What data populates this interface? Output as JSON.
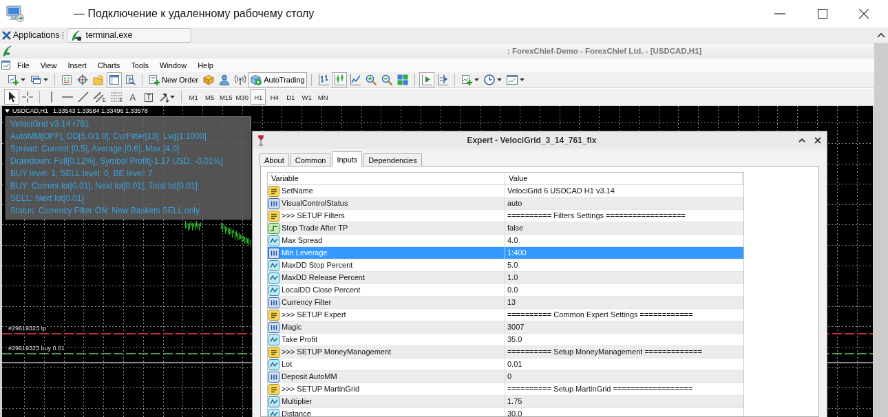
{
  "remote_window": {
    "title": "— Подключение к удаленному рабочему столу"
  },
  "taskbar": {
    "menu_label": "Applications",
    "tasks": [
      {
        "label": "terminal.exe"
      }
    ]
  },
  "terminal": {
    "title": ": ForexChief-Demo - ForexChief Ltd. - [USDCAD,H1]",
    "menu": [
      "File",
      "View",
      "Insert",
      "Charts",
      "Tools",
      "Window",
      "Help"
    ],
    "toolbar": [
      {
        "items": [
          {
            "kind": "new-chart",
            "dropdown": true,
            "on": false
          },
          {
            "kind": "profiles",
            "dropdown": true,
            "on": false
          }
        ]
      },
      {
        "items": [
          {
            "kind": "market-watch",
            "on": false
          },
          {
            "kind": "data-window",
            "on": false
          },
          {
            "kind": "navigator",
            "on": false
          },
          {
            "kind": "terminal",
            "on": true
          },
          {
            "kind": "tester",
            "on": false
          }
        ]
      },
      {
        "items": [
          {
            "kind": "new-order",
            "label": "New Order",
            "on": false
          },
          {
            "kind": "editor",
            "on": false
          },
          {
            "kind": "community",
            "on": false
          },
          {
            "kind": "signals",
            "on": false
          },
          {
            "kind": "autotrading",
            "label": "AutoTrading",
            "on": true
          }
        ]
      },
      {
        "items": [
          {
            "kind": "bar-chart",
            "on": false
          },
          {
            "kind": "candles",
            "on": true
          },
          {
            "kind": "line-chart",
            "on": false
          },
          {
            "kind": "zoom-in",
            "on": false
          },
          {
            "kind": "zoom-out",
            "on": false
          },
          {
            "kind": "tile",
            "on": false
          }
        ]
      },
      {
        "items": [
          {
            "kind": "autoscroll",
            "on": true
          },
          {
            "kind": "chart-shift",
            "on": false
          }
        ]
      },
      {
        "items": [
          {
            "kind": "indicators",
            "dropdown": true,
            "on": false
          },
          {
            "kind": "periods",
            "dropdown": true,
            "on": false
          },
          {
            "kind": "templates",
            "dropdown": true,
            "on": false
          }
        ]
      }
    ],
    "drawing_tools": [
      {
        "items": [
          {
            "kind": "cursor",
            "selected": true
          },
          {
            "kind": "crosshair",
            "selected": false
          }
        ]
      },
      {
        "items": [
          {
            "kind": "vline",
            "selected": false
          },
          {
            "kind": "hline",
            "selected": false
          },
          {
            "kind": "trendline",
            "selected": false
          },
          {
            "kind": "channel",
            "glyph": "E",
            "selected": false
          },
          {
            "kind": "fibo",
            "glyph": "F",
            "selected": false
          },
          {
            "kind": "text",
            "glyph": "A",
            "selected": false
          },
          {
            "kind": "label",
            "glyph": "T",
            "selected": false
          },
          {
            "kind": "arrows",
            "selected": false
          }
        ]
      }
    ],
    "timeframes": [
      {
        "label": "M1",
        "selected": false
      },
      {
        "label": "M5",
        "selected": false
      },
      {
        "label": "M15",
        "selected": false
      },
      {
        "label": "M30",
        "selected": false
      },
      {
        "label": "H1",
        "selected": true
      },
      {
        "label": "H4",
        "selected": false
      },
      {
        "label": "D1",
        "selected": false
      },
      {
        "label": "W1",
        "selected": false
      },
      {
        "label": "MN",
        "selected": false
      }
    ]
  },
  "chart": {
    "symbol": "USDCAD,H1",
    "quotes": "1.33543 1.33584 1.33496 1.33578",
    "info_lines": [
      "VelociGrid v3.14 r761",
      "AutoMM[OFF], DD[5.0/1.0], CurFilter[13], Lvg[1:1000]",
      "Spread: Current [0.5], Average [0.6], Max [4.0]",
      "Drawdown: Full[0.12%], Symbol Profit[-1.17 USD, -0.01%]",
      "BUY level: 1, SELL level: 0, BE level: 7",
      "BUY: Current lot[0.01], Next lot[0.01], Total lot[0.01]",
      "SELL: Next lot[0.01]",
      "Status: Currency Filter ON: New Baskets SELL only."
    ],
    "order_lines": [
      {
        "label": "#29619323 tp",
        "color": "#c03030"
      },
      {
        "label": "#29619323 buy 0.01",
        "color": "#4c9a4c"
      }
    ]
  },
  "expert_dialog": {
    "title": "Expert - VelociGrid_3_14_761_fix",
    "tabs": [
      {
        "label": "About",
        "selected": false
      },
      {
        "label": "Common",
        "selected": false
      },
      {
        "label": "Inputs",
        "selected": true
      },
      {
        "label": "Dependencies",
        "selected": false
      }
    ],
    "columns": [
      "Variable",
      "Value"
    ],
    "rows": [
      {
        "kind": "string",
        "name": "SetName",
        "value": "VelociGrid 6 USDCAD H1 v3.14",
        "selected": false
      },
      {
        "kind": "int",
        "name": "VisualControlStatus",
        "value": "auto",
        "selected": false
      },
      {
        "kind": "string",
        "name": ">>> SETUP Filters",
        "value": "========== Filters Settings ==================",
        "selected": false
      },
      {
        "kind": "bool",
        "name": "Stop Trade After TP",
        "value": "false",
        "selected": false
      },
      {
        "kind": "double",
        "name": "Max Spread",
        "value": "4.0",
        "selected": false
      },
      {
        "kind": "int",
        "name": "Min Leverage",
        "value": "1:400",
        "selected": true
      },
      {
        "kind": "double",
        "name": "MaxDD Stop Percent",
        "value": "5.0",
        "selected": false
      },
      {
        "kind": "double",
        "name": "MaxDD Release Percent",
        "value": "1.0",
        "selected": false
      },
      {
        "kind": "double",
        "name": "LocalDD Close Percent",
        "value": "0.0",
        "selected": false
      },
      {
        "kind": "int",
        "name": "Currency Filter",
        "value": "13",
        "selected": false
      },
      {
        "kind": "string",
        "name": ">>> SETUP Expert",
        "value": "========== Common Expert Settings ============",
        "selected": false
      },
      {
        "kind": "int",
        "name": "Magic",
        "value": "3007",
        "selected": false
      },
      {
        "kind": "double",
        "name": "Take Profit",
        "value": "35.0",
        "selected": false
      },
      {
        "kind": "string",
        "name": ">>> SETUP MoneyManagement",
        "value": "========== Setup MoneyManagement =============",
        "selected": false
      },
      {
        "kind": "double",
        "name": "Lot",
        "value": "0.01",
        "selected": false
      },
      {
        "kind": "int",
        "name": "Deposit AutoMM",
        "value": "0",
        "selected": false
      },
      {
        "kind": "string",
        "name": ">>> SETUP MartinGrid",
        "value": "========== Setup MartinGrid ==================",
        "selected": false
      },
      {
        "kind": "double",
        "name": "Multiplier",
        "value": "1.75",
        "selected": false
      },
      {
        "kind": "double",
        "name": "Distance",
        "value": "30.0",
        "selected": false
      }
    ]
  }
}
